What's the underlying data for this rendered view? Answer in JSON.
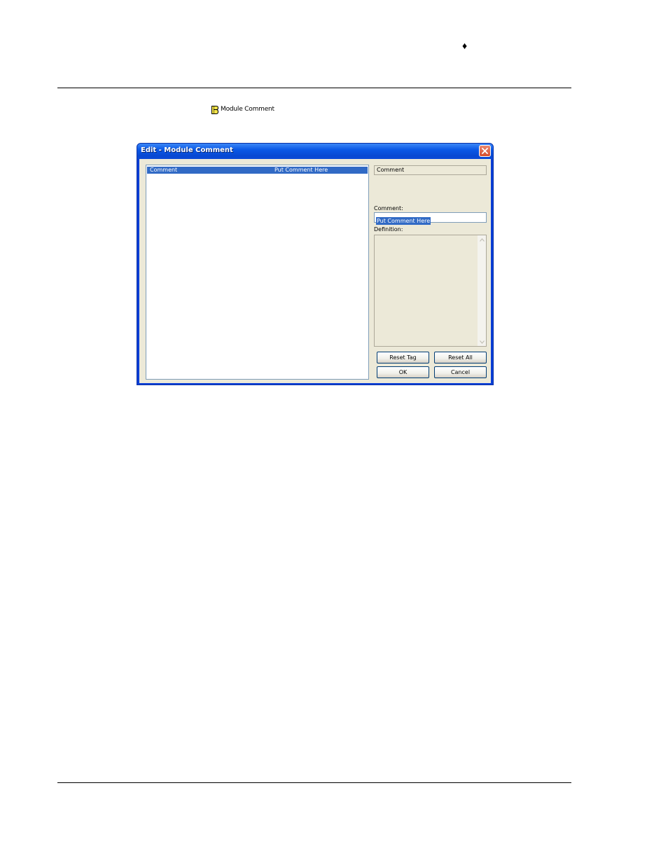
{
  "page": {
    "header_glyph": "♦",
    "menu_entry": {
      "icon": "module-comment-icon",
      "label": "Module Comment"
    }
  },
  "dialog": {
    "title": "Edit - Module Comment",
    "close_icon": "close-icon",
    "list": {
      "rows": [
        {
          "name": "Comment",
          "value": "Put Comment Here",
          "selected": true
        }
      ]
    },
    "tag_name": "Comment",
    "comment_label": "Comment:",
    "comment_value": "Put Comment Here",
    "definition_label": "Definition:",
    "definition_value": "",
    "buttons": {
      "reset_tag": "Reset Tag",
      "reset_all": "Reset All",
      "ok": "OK",
      "cancel": "Cancel"
    }
  },
  "colors": {
    "title_bar": "#0a58e6",
    "selection": "#316ac5",
    "dialog_face": "#ece9d8",
    "close_button": "#d74d2c"
  }
}
